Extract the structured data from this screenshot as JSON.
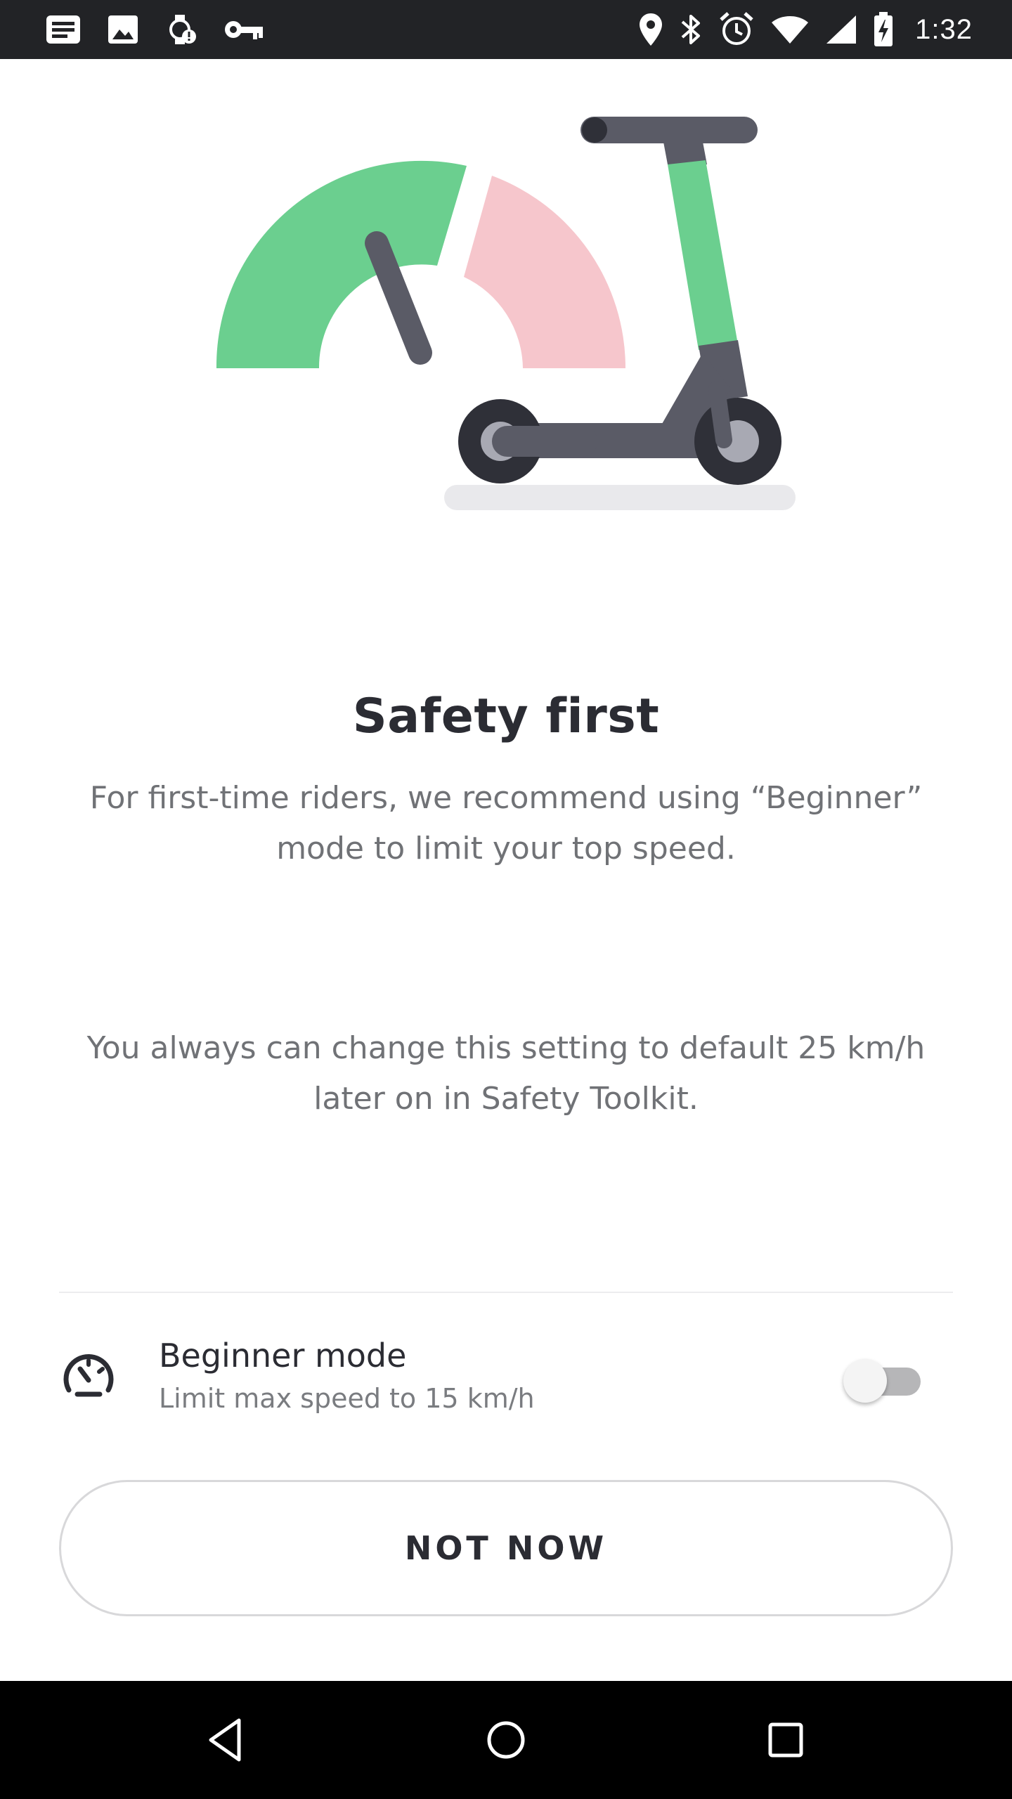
{
  "status_bar": {
    "time": "1:32",
    "left_icons": [
      "notes-icon",
      "image-icon",
      "watch-alert-icon",
      "key-icon"
    ],
    "right_icons": [
      "location-icon",
      "bluetooth-icon",
      "alarm-icon",
      "wifi-icon",
      "cellular-icon",
      "battery-charging-icon"
    ]
  },
  "illustration": {
    "colors": {
      "green": "#6bcf8f",
      "pink": "#f6c6cc",
      "dark": "#5a5b66",
      "tire": "#2f3038",
      "hub": "#a8a9b3",
      "shadow": "#e9e9ec"
    }
  },
  "content": {
    "title": "Safety first",
    "subtitle_line1": "For first-time riders, we recommend using “Beginner”",
    "subtitle_line2": "mode to limit your top speed.",
    "note_line1": "You always can change this setting to default 25 km/h",
    "note_line2": "later on in Safety Toolkit."
  },
  "beginner_mode": {
    "title": "Beginner mode",
    "subtitle": "Limit max speed to 15 km/h",
    "enabled": false,
    "icon": "speedometer-icon"
  },
  "actions": {
    "not_now_label": "NOT NOW"
  },
  "nav_bar": {
    "icons": [
      "back-icon",
      "home-icon",
      "recents-icon"
    ]
  }
}
